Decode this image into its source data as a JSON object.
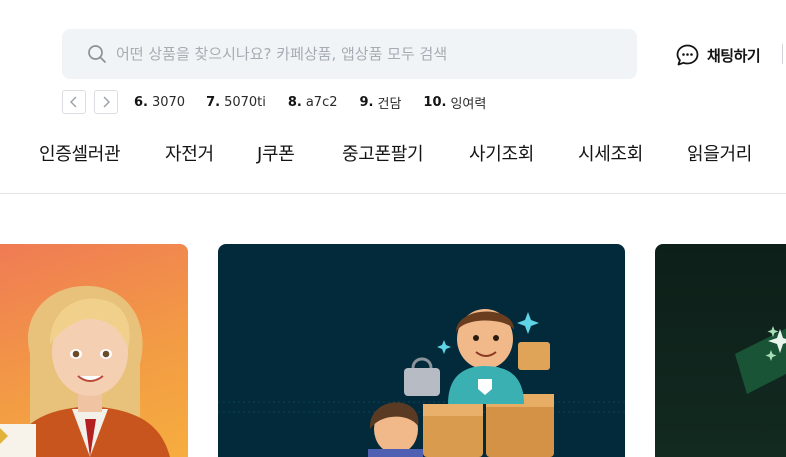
{
  "search": {
    "placeholder": "어떤 상품을 찾으시나요? 카페상품, 앱상품 모두 검색",
    "value": ""
  },
  "header": {
    "chat_label": "채팅하기"
  },
  "popular": {
    "keywords": [
      {
        "rank": "6.",
        "text": "3070"
      },
      {
        "rank": "7.",
        "text": "5070ti"
      },
      {
        "rank": "8.",
        "text": "a7c2"
      },
      {
        "rank": "9.",
        "text": "건담"
      },
      {
        "rank": "10.",
        "text": "잉여력"
      }
    ]
  },
  "nav": {
    "items": [
      "인증셀러관",
      "자전거",
      "J쿠폰",
      "중고폰팔기",
      "사기조회",
      "시세조회",
      "읽을거리"
    ]
  },
  "banners": [
    "promo-seller",
    "promo-delivery",
    "promo-dark"
  ],
  "colors": {
    "search_bg": "#f1f4f6",
    "banner_center_bg": "#022a3a",
    "banner_left_bg": "#f29a45",
    "banner_right_bg": "#0d1f19",
    "text": "#141414"
  }
}
